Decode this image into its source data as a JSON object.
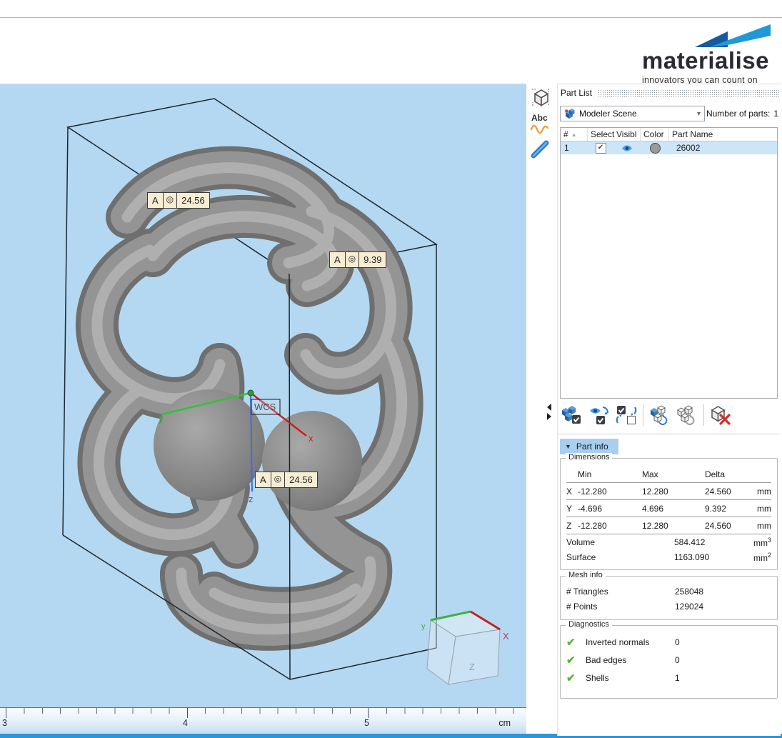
{
  "brand": {
    "name": "materialise",
    "tagline": "innovators you can count on",
    "flag_dark": "#15599f",
    "flag_light": "#1f99d5"
  },
  "icons": {
    "sort_asc": "▲",
    "dropdown_caret": "▾",
    "section_caret": "▼",
    "check": "✔",
    "target": "◎"
  },
  "viewport": {
    "background": "#b4d8f1",
    "measure_labels": [
      {
        "letter": "A",
        "value": "24.56"
      },
      {
        "letter": "A",
        "value": "9.39"
      },
      {
        "letter": "A",
        "value": "24.56"
      }
    ],
    "wcs": "WCS",
    "axes": {
      "x": "x",
      "y": "y",
      "z": "z"
    },
    "nav_cube": {
      "x": "X",
      "y": "y",
      "z": "Z"
    },
    "ruler": {
      "numbers": [
        "3",
        "4",
        "5"
      ],
      "unit": "cm"
    }
  },
  "part_list": {
    "title": "Part List",
    "scene": "Modeler Scene",
    "count_label": "Number of parts:",
    "count_value": "1",
    "columns": {
      "num": "#",
      "select": "Select",
      "visible": "Visibl",
      "color": "Color",
      "name": "Part Name"
    },
    "row": {
      "num": "1",
      "name": "26002",
      "color": "#9a9a9a"
    }
  },
  "part_info": {
    "button": "Part info",
    "dimensions": {
      "legend": "Dimensions",
      "headers": {
        "min": "Min",
        "max": "Max",
        "delta": "Delta"
      },
      "rows": [
        {
          "axis": "X",
          "min": "-12.280",
          "max": "12.280",
          "delta": "24.560",
          "unit": "mm"
        },
        {
          "axis": "Y",
          "min": "-4.696",
          "max": "4.696",
          "delta": "9.392",
          "unit": "mm"
        },
        {
          "axis": "Z",
          "min": "-12.280",
          "max": "12.280",
          "delta": "24.560",
          "unit": "mm"
        }
      ],
      "volume": {
        "label": "Volume",
        "value": "584.412",
        "unit": "mm",
        "sup": "3"
      },
      "surface": {
        "label": "Surface",
        "value": "1163.090",
        "unit": "mm",
        "sup": "2"
      }
    },
    "mesh": {
      "legend": "Mesh info",
      "rows": [
        {
          "label": "# Triangles",
          "value": "258048"
        },
        {
          "label": "# Points",
          "value": "129024"
        }
      ]
    },
    "diagnostics": {
      "legend": "Diagnostics",
      "rows": [
        {
          "label": "Inverted normals",
          "value": "0"
        },
        {
          "label": "Bad edges",
          "value": "0"
        },
        {
          "label": "Shells",
          "value": "1"
        }
      ]
    }
  }
}
